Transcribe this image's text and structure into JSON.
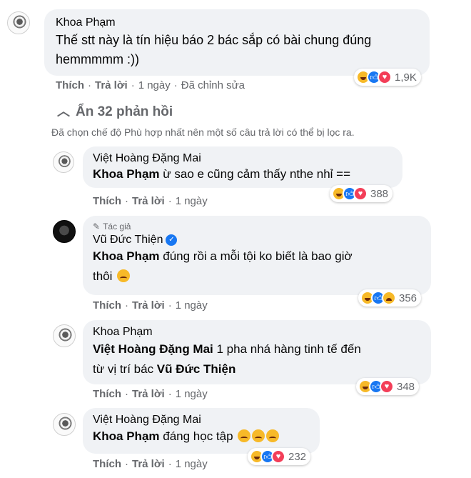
{
  "comments": [
    {
      "author": "Khoa Phạm",
      "text": "Thế stt này là tín hiệu báo 2 bác sắp có bài chung đúng hemmmmm :))",
      "like": "Thích",
      "reply": "Trả lời",
      "time": "1 ngày",
      "edited": "Đã chỉnh sửa",
      "reactions": "1,9K"
    }
  ],
  "hide_replies": "Ẩn 32 phản hồi",
  "filter_note": "Đã chọn chế độ Phù hợp nhất nên một số câu trả lời có thể bị lọc ra.",
  "replies": [
    {
      "author": "Việt Hoàng Đặng Mai",
      "mention": "Khoa Phạm",
      "text": " ừ sao e cũng cảm thấy nthe nhỉ ==",
      "like": "Thích",
      "reply": "Trả lời",
      "time": "1 ngày",
      "reactions": "388"
    },
    {
      "author_tag": "Tác giả",
      "author": "Vũ Đức Thiện",
      "mention": "Khoa Phạm",
      "text_line1": " đúng rồi a mỗi tội ko biết là bao giờ",
      "text_line2": "thôi",
      "like": "Thích",
      "reply": "Trả lời",
      "time": "1 ngày",
      "reactions": "356"
    },
    {
      "author": "Khoa Phạm",
      "mention": "Việt Hoàng Đặng Mai",
      "text_line1": " 1 pha nhá hàng tinh tế đến",
      "text_line2_pre": "từ vị trí bác ",
      "mention2": "Vũ Đức Thiện",
      "like": "Thích",
      "reply": "Trả lời",
      "time": "1 ngày",
      "reactions": "348"
    },
    {
      "author": "Việt Hoàng Đặng Mai",
      "mention": "Khoa Phạm",
      "text": " đáng học tập",
      "like": "Thích",
      "reply": "Trả lời",
      "time": "1 ngày",
      "reactions": "232"
    }
  ],
  "icons": {
    "haha": "haha-reaction-icon",
    "like": "like-reaction-icon",
    "love": "love-reaction-icon",
    "sad": "sad-reaction-icon",
    "chevron": "chevron-up-icon",
    "pen": "pen-icon",
    "verified": "verified-badge-icon"
  },
  "colors": {
    "bubble": "#f0f2f5",
    "secondary_text": "#65676b",
    "like_blue": "#1877f2",
    "love_red": "#f33e58",
    "haha_yellow": "#f7b928"
  }
}
